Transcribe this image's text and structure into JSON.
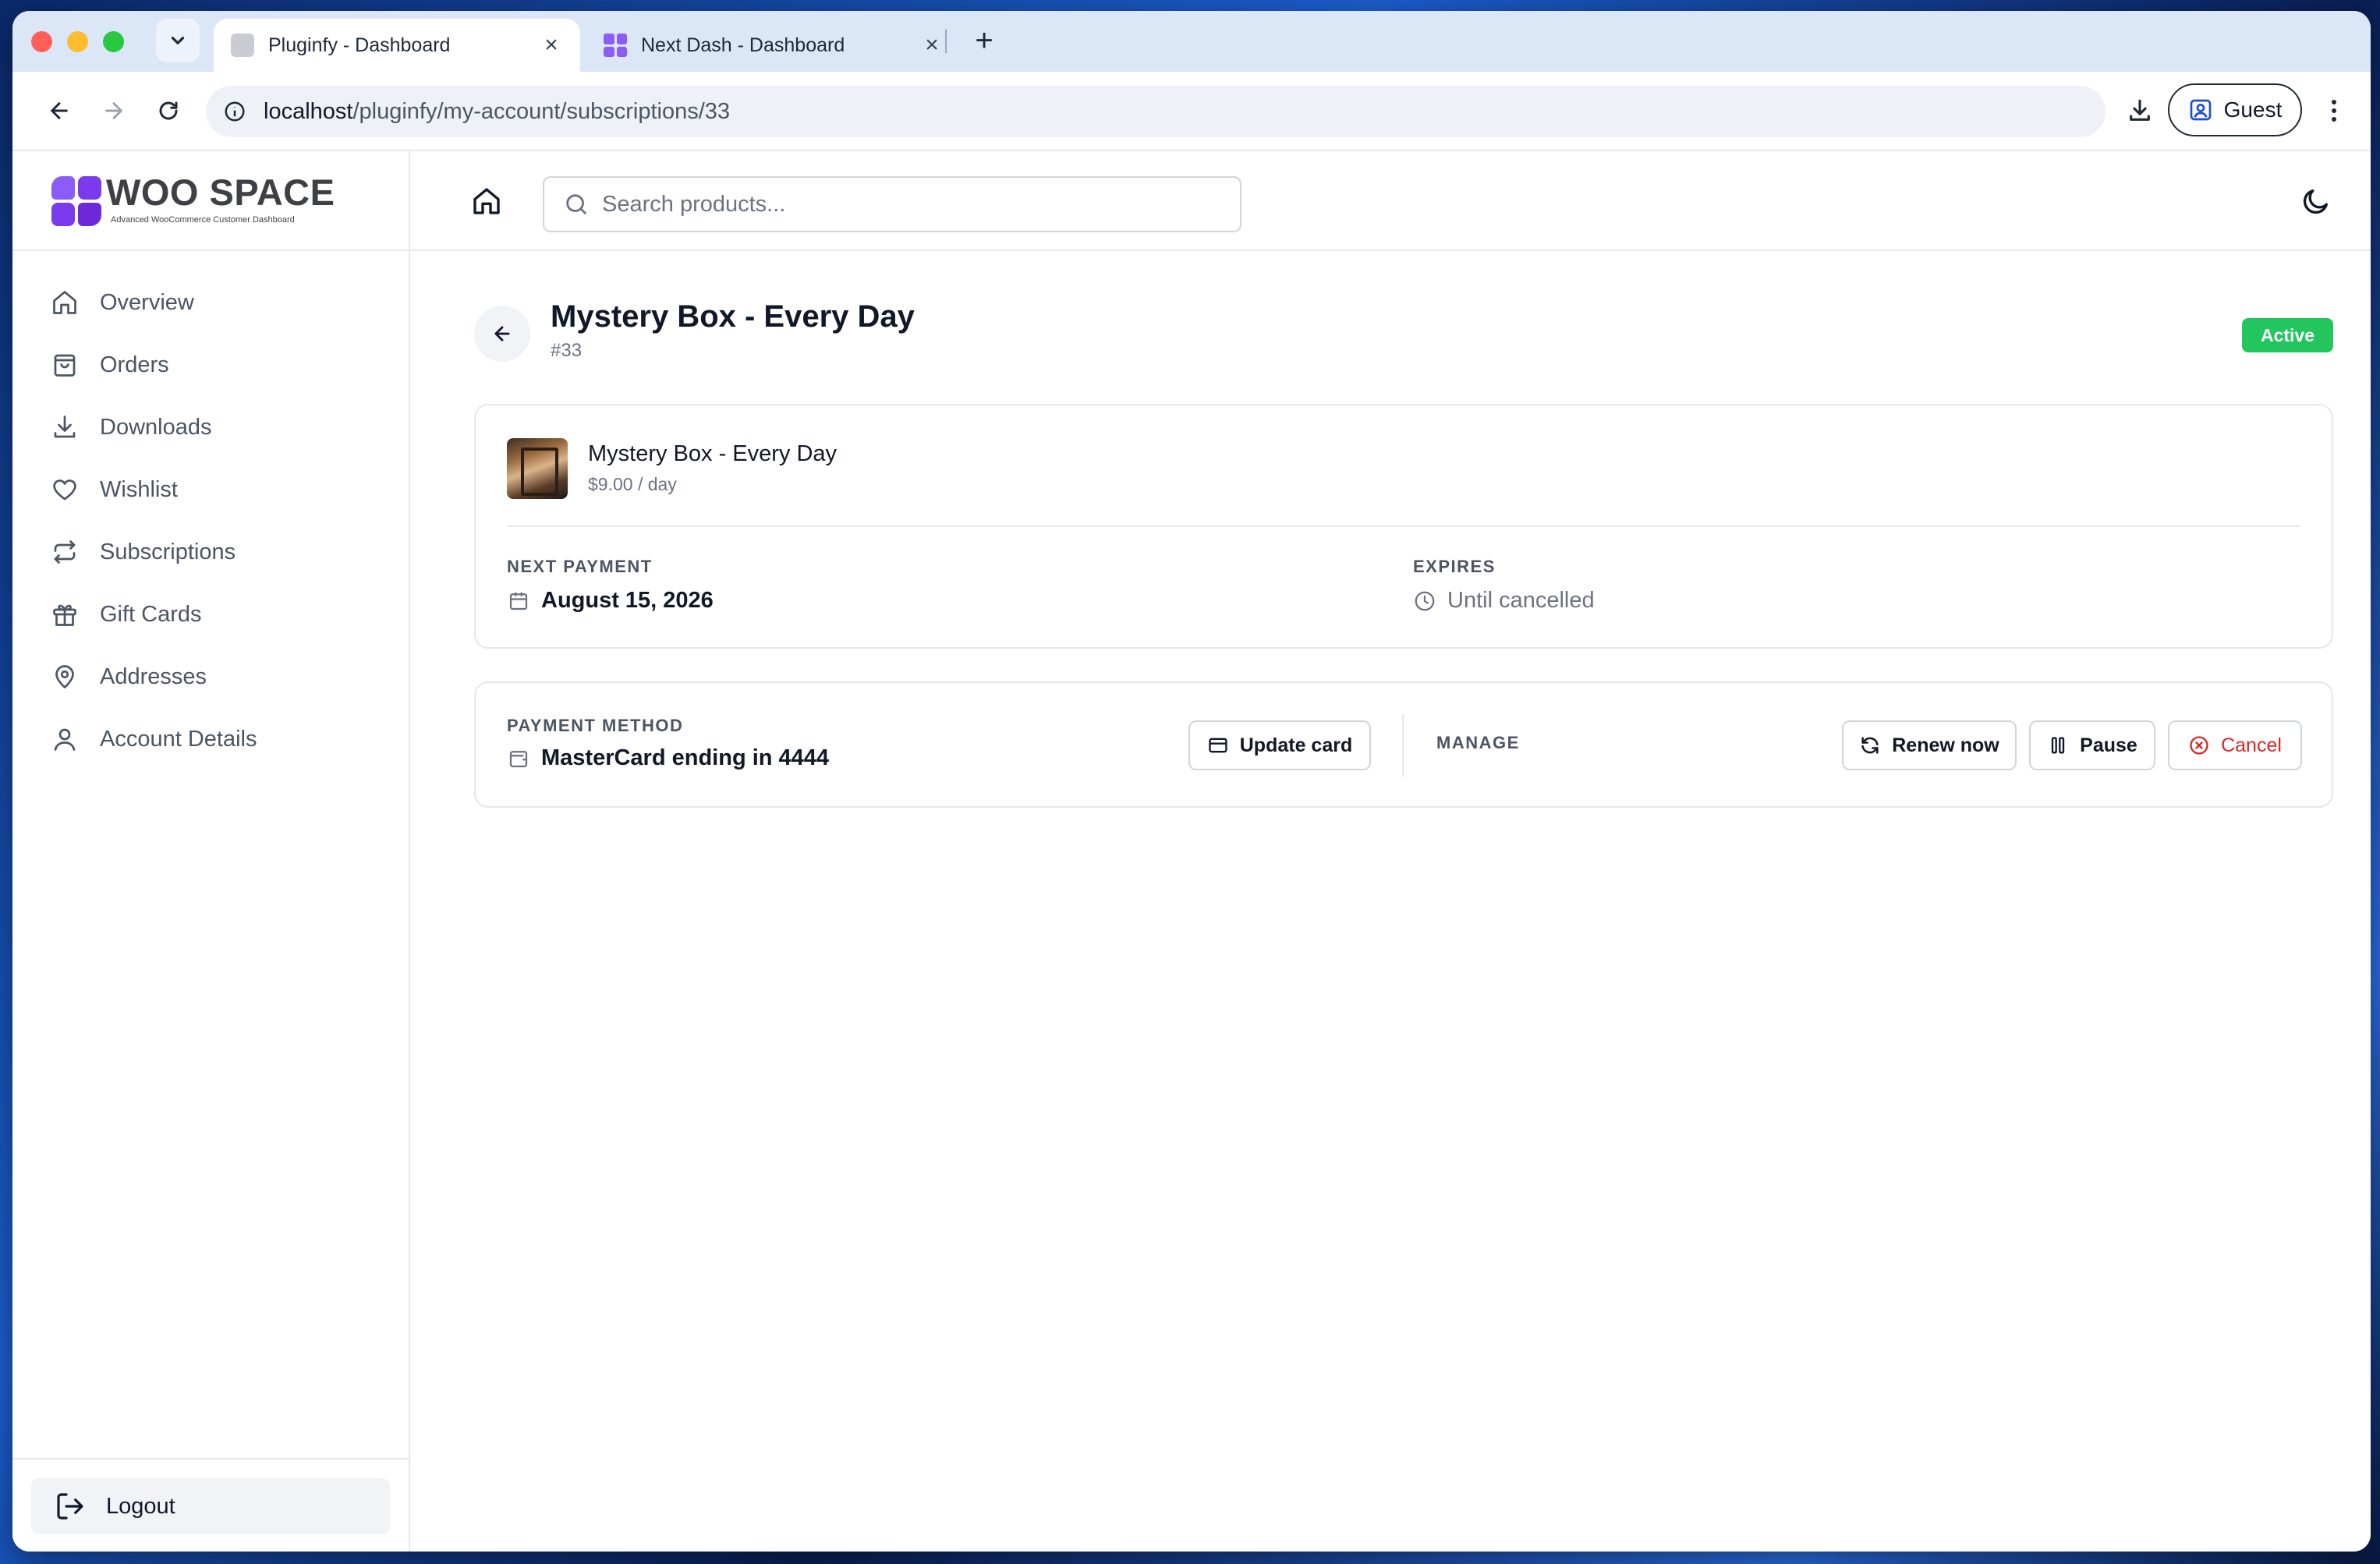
{
  "browser": {
    "tabs": [
      {
        "title": "Pluginfy - Dashboard",
        "active": true
      },
      {
        "title": "Next Dash - Dashboard",
        "active": false
      }
    ],
    "url_host": "localhost",
    "url_path": "/pluginfy/my-account/subscriptions/33",
    "profile_label": "Guest"
  },
  "brand": {
    "name": "WOO SPACE",
    "tagline": "Advanced WooCommerce Customer Dashboard",
    "color": "#7c3aed"
  },
  "sidebar": {
    "items": [
      {
        "label": "Overview",
        "icon": "home-icon"
      },
      {
        "label": "Orders",
        "icon": "shopping-bag-icon"
      },
      {
        "label": "Downloads",
        "icon": "download-icon"
      },
      {
        "label": "Wishlist",
        "icon": "heart-icon"
      },
      {
        "label": "Subscriptions",
        "icon": "repeat-icon"
      },
      {
        "label": "Gift Cards",
        "icon": "gift-icon"
      },
      {
        "label": "Addresses",
        "icon": "map-pin-icon"
      },
      {
        "label": "Account Details",
        "icon": "user-icon"
      }
    ],
    "logout_label": "Logout"
  },
  "header": {
    "search_placeholder": "Search products..."
  },
  "subscription": {
    "title": "Mystery Box - Every Day",
    "id_label": "#33",
    "status": "Active",
    "status_color": "#22c55e",
    "product_name": "Mystery Box - Every Day",
    "product_price": "$9.00 / day",
    "next_payment_label": "NEXT PAYMENT",
    "next_payment_value": "August 15, 2026",
    "expires_label": "EXPIRES",
    "expires_value": "Until cancelled"
  },
  "payment": {
    "method_label": "PAYMENT METHOD",
    "method_value": "MasterCard ending in 4444",
    "update_card_label": "Update card",
    "manage_label": "MANAGE",
    "renew_label": "Renew now",
    "pause_label": "Pause",
    "cancel_label": "Cancel",
    "cancel_color": "#dc2626"
  }
}
